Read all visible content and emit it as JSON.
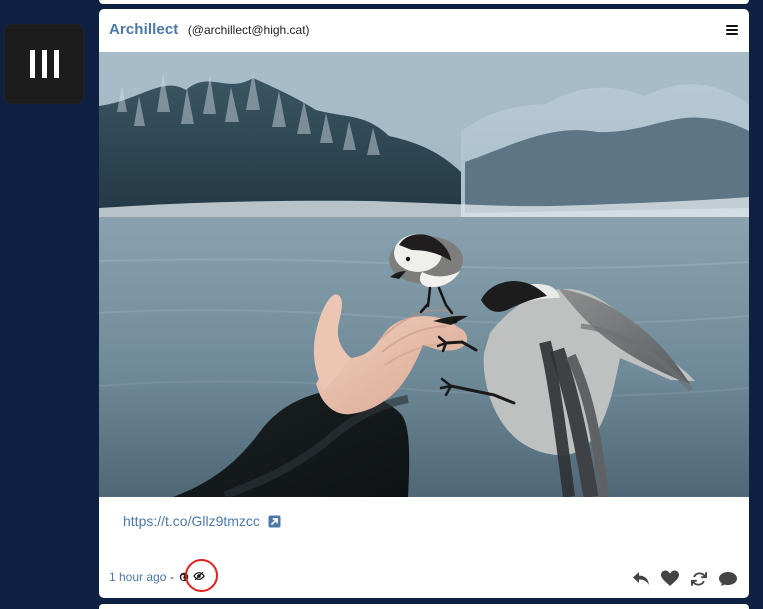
{
  "sidebar": {
    "menu_icon": "menu-bars-icon"
  },
  "post": {
    "author": {
      "name": "Archillect",
      "handle": "(@archillect@high.cat)"
    },
    "menu_icon": "hamburger-icon",
    "image": {
      "subject": "two birds perched on an outstretched hand beside a snowy lake"
    },
    "link": {
      "text": "https://t.co/Gllz9tmzcc",
      "icon": "external-link-icon"
    },
    "meta": {
      "time": "1 hour ago",
      "separator": "-",
      "visibility_icon": "globe-icon",
      "eye_icon": "eye-icon"
    },
    "actions": {
      "reply_icon": "reply-icon",
      "like_icon": "heart-icon",
      "boost_icon": "boost-icon",
      "comment_icon": "comment-icon"
    }
  },
  "colors": {
    "background": "#0f2142",
    "card": "#ffffff",
    "accent": "#4c78a8",
    "highlight_ring": "#e01f1f"
  }
}
